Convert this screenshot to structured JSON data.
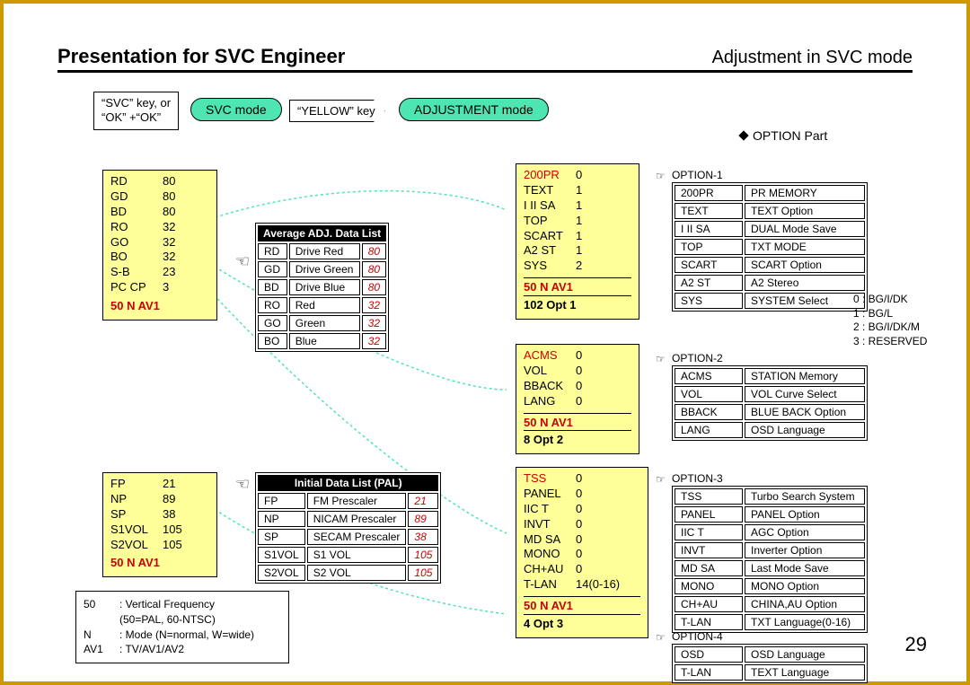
{
  "header": {
    "left": "Presentation for SVC Engineer",
    "right": "Adjustment in SVC mode"
  },
  "page_number": "29",
  "flow": {
    "label1a": "“SVC” key, or",
    "label1b": "“OK” +“OK”",
    "bubble1": "SVC mode",
    "arrow2": "“YELLOW” key",
    "bubble2": "ADJUSTMENT  mode"
  },
  "section_title": "OPTION Part",
  "ybox1": {
    "rows": [
      {
        "k": "RD",
        "v": "80"
      },
      {
        "k": "GD",
        "v": "80"
      },
      {
        "k": "BD",
        "v": "80"
      },
      {
        "k": "RO",
        "v": "32"
      },
      {
        "k": "GO",
        "v": "32"
      },
      {
        "k": "BO",
        "v": "32"
      },
      {
        "k": "S-B",
        "v": "23"
      },
      {
        "k": "PC CP",
        "v": "3"
      }
    ],
    "status": "50  N  AV1"
  },
  "ybox2": {
    "rows": [
      {
        "k": "FP",
        "v": "21"
      },
      {
        "k": "NP",
        "v": "89"
      },
      {
        "k": "SP",
        "v": "38"
      },
      {
        "k": "S1VOL",
        "v": "105"
      },
      {
        "k": "S2VOL",
        "v": "105"
      }
    ],
    "status": "50  N  AV1"
  },
  "ybox_opt1": {
    "rows": [
      {
        "k": "200PR",
        "v": "0",
        "kr": true
      },
      {
        "k": "TEXT",
        "v": "1"
      },
      {
        "k": "I II SA",
        "v": "1"
      },
      {
        "k": "TOP",
        "v": "1"
      },
      {
        "k": "SCART",
        "v": "1"
      },
      {
        "k": "A2 ST",
        "v": "1"
      },
      {
        "k": "SYS",
        "v": "2"
      }
    ],
    "status": "50  N  AV1",
    "opt": "102   Opt 1"
  },
  "ybox_opt2": {
    "rows": [
      {
        "k": "ACMS",
        "v": "0",
        "kr": true
      },
      {
        "k": "VOL",
        "v": "0"
      },
      {
        "k": "BBACK",
        "v": "0"
      },
      {
        "k": "LANG",
        "v": "0"
      }
    ],
    "status": "50  N  AV1",
    "opt": "8    Opt 2"
  },
  "ybox_opt3": {
    "rows": [
      {
        "k": "TSS",
        "v": "0",
        "kr": true
      },
      {
        "k": "PANEL",
        "v": "0"
      },
      {
        "k": "IIC T",
        "v": "0"
      },
      {
        "k": "INVT",
        "v": "0"
      },
      {
        "k": "MD SA",
        "v": "0"
      },
      {
        "k": "MONO",
        "v": "0"
      },
      {
        "k": "CH+AU",
        "v": "0"
      },
      {
        "k": "T-LAN",
        "v": "14(0-16)"
      }
    ],
    "status": "50  N  AV1",
    "opt": "4    Opt 3"
  },
  "adjtable": {
    "title": "Average ADJ. Data List",
    "rows": [
      {
        "c1": "RD",
        "c2": "Drive Red",
        "c3": "80"
      },
      {
        "c1": "GD",
        "c2": "Drive Green",
        "c3": "80"
      },
      {
        "c1": "BD",
        "c2": "Drive Blue",
        "c3": "80"
      },
      {
        "c1": "RO",
        "c2": "Red",
        "c3": "32"
      },
      {
        "c1": "GO",
        "c2": "Green",
        "c3": "32"
      },
      {
        "c1": "BO",
        "c2": "Blue",
        "c3": "32"
      }
    ]
  },
  "inittable": {
    "title": "Initial  Data List (PAL)",
    "rows": [
      {
        "c1": "FP",
        "c2": "FM Prescaler",
        "c3": "21"
      },
      {
        "c1": "NP",
        "c2": "NICAM Prescaler",
        "c3": "89"
      },
      {
        "c1": "SP",
        "c2": "SECAM Prescaler",
        "c3": "38"
      },
      {
        "c1": "S1VOL",
        "c2": "S1 VOL",
        "c3": "105"
      },
      {
        "c1": "S2VOL",
        "c2": "S2 VOL",
        "c3": "105"
      }
    ]
  },
  "opt1_label": "OPTION-1",
  "opt1": [
    {
      "c1": "200PR",
      "c2": "PR MEMORY"
    },
    {
      "c1": "TEXT",
      "c2": "TEXT Option"
    },
    {
      "c1": "I II SA",
      "c2": "DUAL Mode Save"
    },
    {
      "c1": "TOP",
      "c2": "TXT MODE"
    },
    {
      "c1": "SCART",
      "c2": "SCART Option"
    },
    {
      "c1": "A2 ST",
      "c2": "A2 Stereo"
    },
    {
      "c1": "SYS",
      "c2": "SYSTEM Select"
    }
  ],
  "opt2_label": "OPTION-2",
  "opt2": [
    {
      "c1": "ACMS",
      "c2": "STATION Memory"
    },
    {
      "c1": "VOL",
      "c2": "VOL Curve Select"
    },
    {
      "c1": "BBACK",
      "c2": "BLUE BACK Option"
    },
    {
      "c1": "LANG",
      "c2": "OSD Language"
    }
  ],
  "opt3_label": "OPTION-3",
  "opt3": [
    {
      "c1": "TSS",
      "c2": "Turbo Search System"
    },
    {
      "c1": "PANEL",
      "c2": "PANEL Option"
    },
    {
      "c1": "IIC T",
      "c2": "AGC Option"
    },
    {
      "c1": "INVT",
      "c2": "Inverter Option"
    },
    {
      "c1": "MD SA",
      "c2": "Last Mode Save"
    },
    {
      "c1": "MONO",
      "c2": "MONO Option"
    },
    {
      "c1": "CH+AU",
      "c2": "CHINA,AU Option"
    },
    {
      "c1": "T-LAN",
      "c2": "TXT Language(0-16)"
    }
  ],
  "opt4_label": "OPTION-4",
  "opt4": [
    {
      "c1": "OSD",
      "c2": "OSD Language"
    },
    {
      "c1": "T-LAN",
      "c2": "TEXT Language"
    }
  ],
  "syskey": {
    "l0": "0 : BG/I/DK",
    "l1": "1 : BG/L",
    "l2": "2 : BG/I/DK/M",
    "l3": "3 : RESERVED"
  },
  "legend": {
    "r1k": "50",
    "r1v": ": Vertical Frequency",
    "r1v2": "(50=PAL, 60-NTSC)",
    "r2k": "N",
    "r2v": ": Mode (N=normal, W=wide)",
    "r3k": "AV1",
    "r3v": ": TV/AV1/AV2"
  }
}
